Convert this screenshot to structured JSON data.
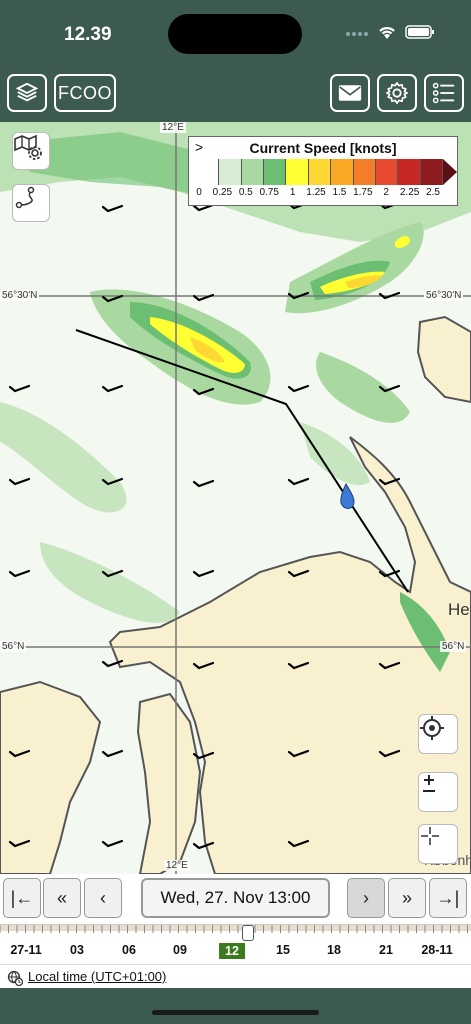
{
  "status": {
    "time": "12.39"
  },
  "toolbar": {
    "fcoo_label": "FCOO"
  },
  "legend": {
    "title": "Current Speed [knots]",
    "collapse_glyph": ">",
    "labels": [
      "0",
      "0.25",
      "0.5",
      "0.75",
      "1",
      "1.25",
      "1.5",
      "1.75",
      "2",
      "2.25",
      "2.5"
    ],
    "colors": [
      "#ffffff",
      "#d7ecd2",
      "#a9d9a0",
      "#6cbf72",
      "#ffff33",
      "#fdd835",
      "#f9a825",
      "#f57c28",
      "#e84a2f",
      "#c62828",
      "#8e1b20",
      "#5a0f14"
    ]
  },
  "map": {
    "lon_label": "12°E",
    "lat_top_left": "56°30'N",
    "lat_top_right": "56°30'N",
    "lat_mid_left": "56°N",
    "lat_mid_right": "56°N",
    "place_he": "He",
    "place_kob": "København"
  },
  "timebar": {
    "first": "|←",
    "fast_back": "«",
    "back": "‹",
    "date": "Wed, 27. Nov 13:00",
    "forward": "›",
    "fast_forward": "»",
    "last": "→|"
  },
  "ruler": {
    "labels": [
      "27-11",
      "03",
      "06",
      "09",
      "12",
      "15",
      "18",
      "21",
      "28-11"
    ],
    "active": "12"
  },
  "footer": {
    "local_time": "Local time (UTC+01:00)"
  }
}
